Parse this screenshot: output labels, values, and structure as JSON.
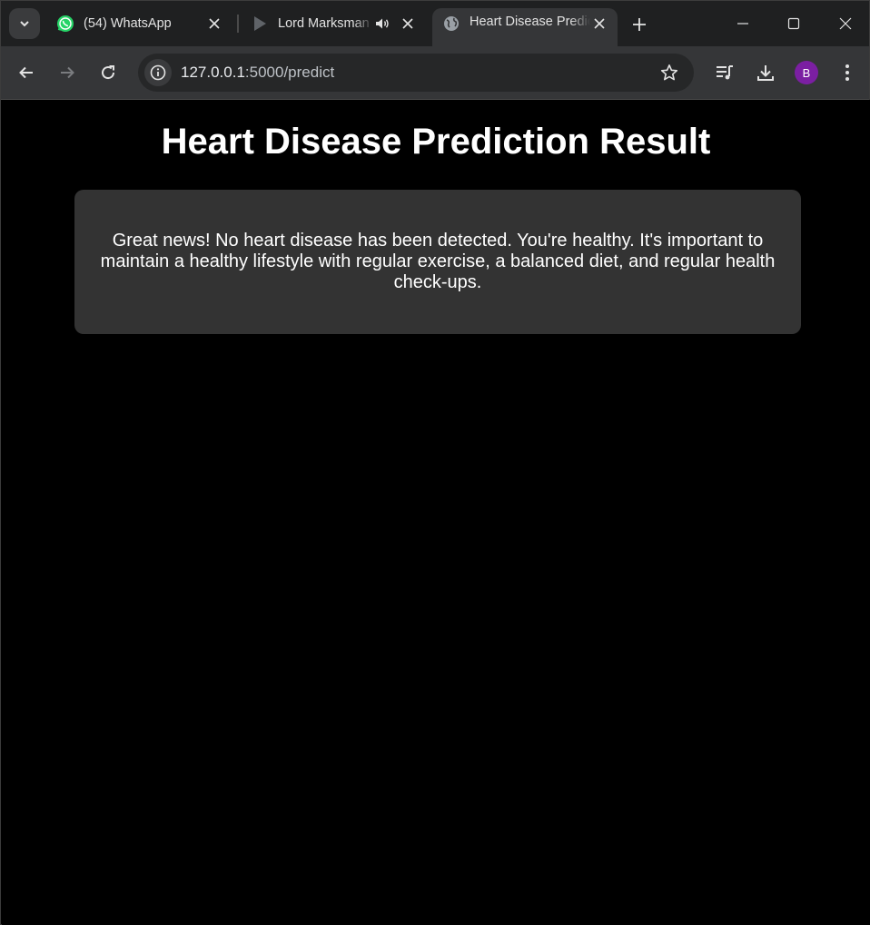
{
  "browser": {
    "tabs": [
      {
        "title": "(54) WhatsApp",
        "favicon": "whatsapp-icon",
        "active": false
      },
      {
        "title": "Lord Marksman",
        "favicon": "play-icon",
        "audio": true,
        "active": false
      },
      {
        "title": "Heart Disease Prediction Result",
        "favicon": "globe-icon",
        "active": true
      }
    ],
    "address_bar": {
      "host": "127.0.0.1",
      "rest": ":5000/predict"
    },
    "profile_initial": "B",
    "colors": {
      "tabstrip": "#1f2021",
      "toolbar": "#353638",
      "whatsapp": "#25d366",
      "avatar": "#7b1fa2"
    }
  },
  "page": {
    "title": "Heart Disease Prediction Result",
    "result_message": "Great news! No heart disease has been detected. You're healthy. It's important to maintain a healthy lifestyle with regular exercise, a balanced diet, and regular health check-ups.",
    "colors": {
      "background": "#000000",
      "card": "#333333",
      "text": "#ffffff"
    }
  }
}
